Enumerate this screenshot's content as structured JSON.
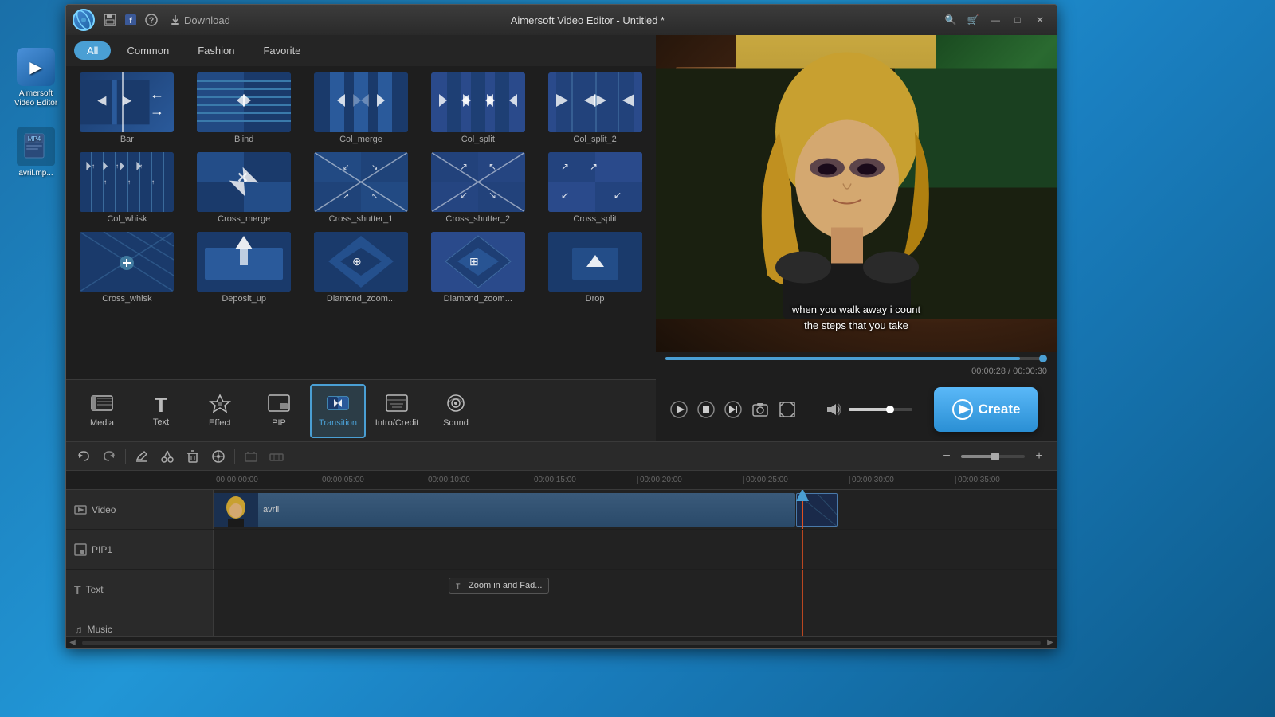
{
  "app": {
    "title": "Aimersoft Video Editor - Untitled *",
    "logo_char": "A"
  },
  "titlebar": {
    "save_label": "💾",
    "info_label": "ℹ",
    "help_label": "?",
    "download_label": "Download",
    "minimize": "—",
    "maximize": "□",
    "close": "✕"
  },
  "filter_tabs": {
    "all": "All",
    "common": "Common",
    "fashion": "Fashion",
    "favorite": "Favorite"
  },
  "transitions": [
    {
      "id": "bar",
      "label": "Bar",
      "type": "bar"
    },
    {
      "id": "blind",
      "label": "Blind",
      "type": "blind"
    },
    {
      "id": "col_merge",
      "label": "Col_merge",
      "type": "col_merge"
    },
    {
      "id": "col_split",
      "label": "Col_split",
      "type": "col_split"
    },
    {
      "id": "col_split_2",
      "label": "Col_split_2",
      "type": "col_split_2"
    },
    {
      "id": "col_whisk",
      "label": "Col_whisk",
      "type": "col_whisk"
    },
    {
      "id": "cross_merge",
      "label": "Cross_merge",
      "type": "cross_merge"
    },
    {
      "id": "cross_shutter_1",
      "label": "Cross_shutter_1",
      "type": "cross_shutter_1"
    },
    {
      "id": "cross_shutter_2",
      "label": "Cross_shutter_2",
      "type": "cross_shutter_2"
    },
    {
      "id": "cross_split",
      "label": "Cross_split",
      "type": "cross_split"
    },
    {
      "id": "cross_whisk",
      "label": "Cross_whisk",
      "type": "cross_whisk"
    },
    {
      "id": "deposit_up",
      "label": "Deposit_up",
      "type": "deposit_up"
    },
    {
      "id": "diamond_zoom_1",
      "label": "Diamond_zoom...",
      "type": "diamond_zoom_1"
    },
    {
      "id": "diamond_zoom_2",
      "label": "Diamond_zoom...",
      "type": "diamond_zoom_2"
    },
    {
      "id": "drop",
      "label": "Drop",
      "type": "drop"
    }
  ],
  "tools": [
    {
      "id": "media",
      "label": "Media",
      "icon": "🎬"
    },
    {
      "id": "text",
      "label": "Text",
      "icon": "T"
    },
    {
      "id": "effect",
      "label": "Effect",
      "icon": "✨"
    },
    {
      "id": "pip",
      "label": "PIP",
      "icon": "📺"
    },
    {
      "id": "transition",
      "label": "Transition",
      "icon": "⇄",
      "active": true
    },
    {
      "id": "intro_credit",
      "label": "Intro/Credit",
      "icon": "🎞"
    },
    {
      "id": "sound",
      "label": "Sound",
      "icon": "🎧"
    }
  ],
  "playback": {
    "current_time": "00:00:28",
    "total_time": "00:00:30",
    "play": "▶",
    "stop": "■",
    "step_fwd": "⏭",
    "snapshot": "📷",
    "fullscreen": "⛶",
    "volume": "🔊"
  },
  "subtitle": {
    "line1": "when you walk away i count",
    "line2": "the steps that you take"
  },
  "create_btn": "Create",
  "timeline": {
    "tracks": [
      {
        "id": "video",
        "label": "Video",
        "icon": "🎬"
      },
      {
        "id": "pip1",
        "label": "PIP1",
        "icon": "📺"
      },
      {
        "id": "text",
        "label": "Text",
        "icon": "T"
      },
      {
        "id": "music",
        "label": "Music",
        "icon": "♫"
      }
    ],
    "ruler": [
      "00:00:00:00",
      "00:00:05:00",
      "00:00:10:00",
      "00:00:15:00",
      "00:00:20:00",
      "00:00:25:00",
      "00:00:30:00",
      "00:00:35:00"
    ],
    "video_clip_name": "avril",
    "tooltip": "Zoom in and Fad..."
  },
  "desktop": {
    "icon1_line1": "Aimerso",
    "icon1_line2": "ft",
    "icon1_line3": "Video Edi",
    "icon1_line4": "tor",
    "icon2": "avril.mp..."
  }
}
